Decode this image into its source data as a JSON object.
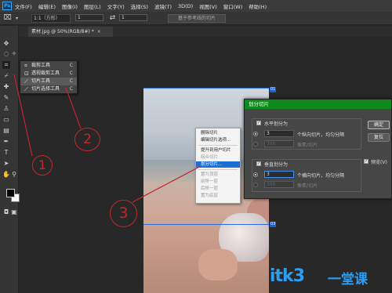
{
  "menubar": {
    "logo": "Ps",
    "items": [
      "文件(F)",
      "编辑(E)",
      "图像(I)",
      "图层(L)",
      "文字(Y)",
      "选择(S)",
      "滤镜(T)",
      "3D(D)",
      "视图(V)",
      "窗口(W)",
      "帮助(H)"
    ]
  },
  "options": {
    "ratio": "1:1（方形）",
    "width": "1",
    "height": "1",
    "swap_icon": "swap-icon",
    "slice_btn": "基于参考线的切片"
  },
  "tabs": [
    {
      "label": "素材.jpg @ 50%(RGB/8#) *",
      "close": "×"
    }
  ],
  "tool_flyout": [
    {
      "icon": "crop-icon",
      "label": "裁剪工具",
      "shortcut": "C",
      "selected": false
    },
    {
      "icon": "perspective-crop-icon",
      "label": "透视裁剪工具",
      "shortcut": "C",
      "selected": false
    },
    {
      "icon": "slice-icon",
      "label": "切片工具",
      "shortcut": "C",
      "selected": true
    },
    {
      "icon": "slice-select-icon",
      "label": "切片选择工具",
      "shortcut": "C",
      "selected": false
    }
  ],
  "canvas": {
    "slice_badges": [
      "01",
      "03"
    ]
  },
  "context_menu": {
    "items": [
      {
        "label": "删除切片",
        "state": "enabled"
      },
      {
        "label": "编辑切片选项...",
        "state": "enabled"
      },
      {
        "label": "提升到用户切片",
        "state": "enabled"
      },
      {
        "label": "组合切片",
        "state": "disabled"
      },
      {
        "label": "划分切片...",
        "state": "selected"
      },
      {
        "label": "置为顶层",
        "state": "disabled"
      },
      {
        "label": "前移一层",
        "state": "disabled"
      },
      {
        "label": "后移一层",
        "state": "disabled"
      },
      {
        "label": "置为底层",
        "state": "disabled"
      }
    ]
  },
  "dialog": {
    "title": "划分切片",
    "horizontal": {
      "checkbox_label": "水平划分为",
      "checked": true,
      "count_value": "3",
      "count_suffix": "个纵向切片，均匀分隔",
      "pixels_value": "300",
      "pixels_suffix": "像素/切片"
    },
    "vertical": {
      "checkbox_label": "垂直划分为",
      "checked": true,
      "count_value": "3",
      "count_suffix": "个横向切片，均匀分隔",
      "pixels_value": "300",
      "pixels_suffix": "像素/切片"
    },
    "ok_label": "确定",
    "reset_label": "复位",
    "preview_label": "预览(V)",
    "preview_checked": true
  },
  "annotations": [
    "1",
    "2",
    "3"
  ],
  "watermark": {
    "main": "itk3",
    "sub": "一堂课"
  },
  "colors": {
    "dialog_title_bg": "#0e8a1c",
    "annotation": "#c0272d",
    "slice_line": "#2a6be0",
    "menu_highlight": "#1d6fd6",
    "watermark": "#2a9df4"
  }
}
